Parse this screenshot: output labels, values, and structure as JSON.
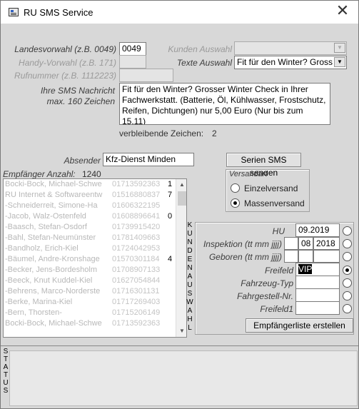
{
  "window": {
    "title": "RU SMS Service",
    "close_glyph": "✕"
  },
  "form": {
    "landesvorwahl_label": "Landesvorwahl (z.B. 0049)",
    "landesvorwahl_value": "0049",
    "handyvorwahl_label": "Handy-Vorwahl (z.B. 171)",
    "rufnummer_label": "Rufnummer (z.B. 1112223)",
    "kunden_auswahl_label": "Kunden Auswahl",
    "texte_auswahl_label": "Texte Auswahl",
    "texte_auswahl_value": "Fit für den Winter? Gross",
    "nachricht_label1": "Ihre SMS Nachricht",
    "nachricht_label2": "max. 160 Zeichen",
    "nachricht_text": "Fit für den Winter? Grosser Winter Check in Ihrer Fachwerkstatt. (Batterie, Öl, Kühlwasser, Frostschutz, Reifen, Dichtungen) nur 5,00 Euro (Nur bis zum 15.11)",
    "verbleibend_label": "verbleibende Zeichen:",
    "verbleibend_value": "2",
    "absender_label": "Absender",
    "absender_value": "Kfz-Dienst Minden",
    "serien_button": "Serien SMS senden"
  },
  "versandart": {
    "title": "Versandart",
    "option1": "Einzelversand",
    "option2": "Massenversand",
    "selected": "Massenversand"
  },
  "recipients": {
    "count_label": "Empfänger Anzahl:",
    "count_value": "1240",
    "rows": [
      {
        "name": "Bocki-Bock, Michael-Schwe",
        "tel": "01713592363",
        "tail": "1"
      },
      {
        "name": "RU Internet & Softwareentw",
        "tel": "01516880837",
        "tail": "7"
      },
      {
        "name": "-Schneiderreit, Simone-Ha",
        "tel": "01606322195",
        "tail": ""
      },
      {
        "name": "-Jacob, Walz-Ostenfeld",
        "tel": "01608896641",
        "tail": "0"
      },
      {
        "name": "-Baasch, Stefan-Osdorf",
        "tel": "01739915420",
        "tail": ""
      },
      {
        "name": "-Bahl, Stefan-Neumünster",
        "tel": "01781409663",
        "tail": ""
      },
      {
        "name": "-Bandholz, Erich-Kiel",
        "tel": "01724042953",
        "tail": ""
      },
      {
        "name": "-Bäumel, Andre-Kronshage",
        "tel": "01570301184",
        "tail": "4"
      },
      {
        "name": "-Becker, Jens-Bordesholm",
        "tel": "01708907133",
        "tail": ""
      },
      {
        "name": "-Beeck, Knut Kuddel-Kiel",
        "tel": "01627054844",
        "tail": ""
      },
      {
        "name": "-Behrens, Marco-Norderste",
        "tel": "01716301131",
        "tail": ""
      },
      {
        "name": "-Berke, Marina-Kiel",
        "tel": "01717269403",
        "tail": ""
      },
      {
        "name": "-Bern, Thorsten-",
        "tel": "01715206149",
        "tail": ""
      },
      {
        "name": "Bocki-Bock, Michael-Schwe",
        "tel": "01713592363",
        "tail": ""
      }
    ],
    "vertical_label": [
      "K",
      "U",
      "N",
      "D",
      "E",
      "N",
      "A",
      "U",
      "S",
      "W",
      "A",
      "H",
      "L"
    ]
  },
  "filters": {
    "hu_label": "HU",
    "hu_value": "09.2019",
    "inspektion_label": "Inspektion (tt mm jjjj)",
    "inspektion_mm": "08",
    "inspektion_yyyy": "2018",
    "geboren_label": "Geboren (tt mm jjjj)",
    "freifeld_label": "Freifeld",
    "freifeld_value": "VIP",
    "fahrzeugtyp_label": "Fahrzeug-Typ",
    "fahrgestell_label": "Fahrgestell-Nr.",
    "freifeld1_label": "Freifeld1",
    "selected": "Freifeld",
    "erstellen_button": "Empfängerliste erstellen"
  },
  "status": {
    "vertical_label": [
      "S",
      "T",
      "A",
      "T",
      "U",
      "S"
    ]
  }
}
